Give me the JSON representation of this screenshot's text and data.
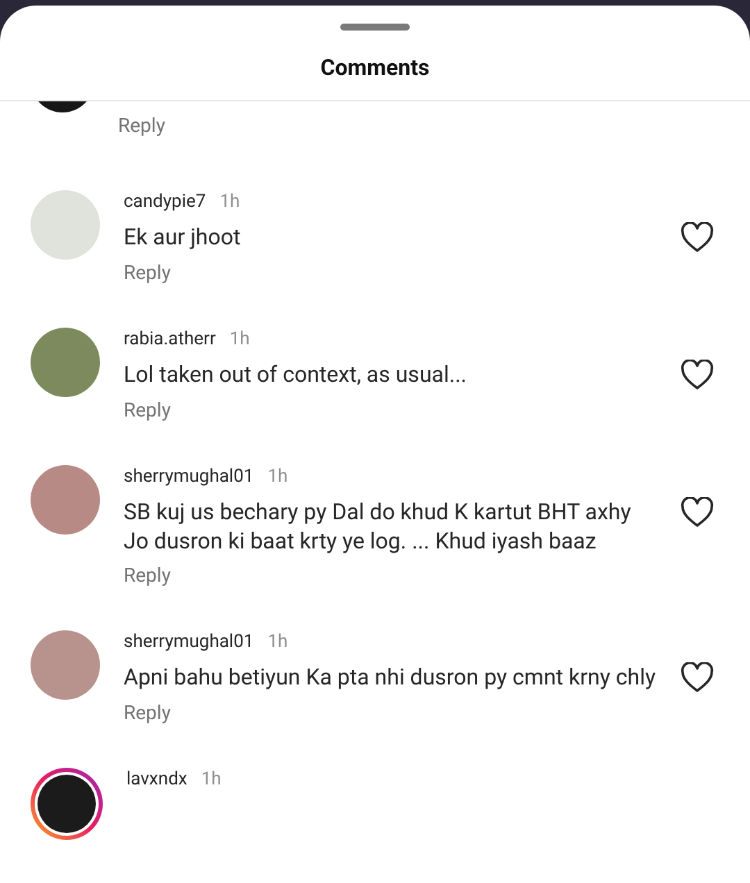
{
  "sheet": {
    "title": "Comments"
  },
  "top_partial": {
    "reply": "Reply"
  },
  "comments": [
    {
      "username": "candypie7",
      "time": "1h",
      "text": "Ek aur jhoot",
      "reply": "Reply",
      "story_ring": false
    },
    {
      "username": "rabia.atherr",
      "time": "1h",
      "text": "Lol taken out of context, as usual...",
      "reply": "Reply",
      "story_ring": false
    },
    {
      "username": "sherrymughal01",
      "time": "1h",
      "text": "SB kuj us bechary py Dal do khud K kartut BHT axhy Jo dusron ki baat krty ye log. ... Khud iyash baaz",
      "reply": "Reply",
      "story_ring": false
    },
    {
      "username": "sherrymughal01",
      "time": "1h",
      "text": "Apni bahu betiyun Ka pta nhi dusron py cmnt krny chly",
      "reply": "Reply",
      "story_ring": false
    },
    {
      "username": "lavxndx",
      "time": "1h",
      "story_ring": true
    }
  ]
}
